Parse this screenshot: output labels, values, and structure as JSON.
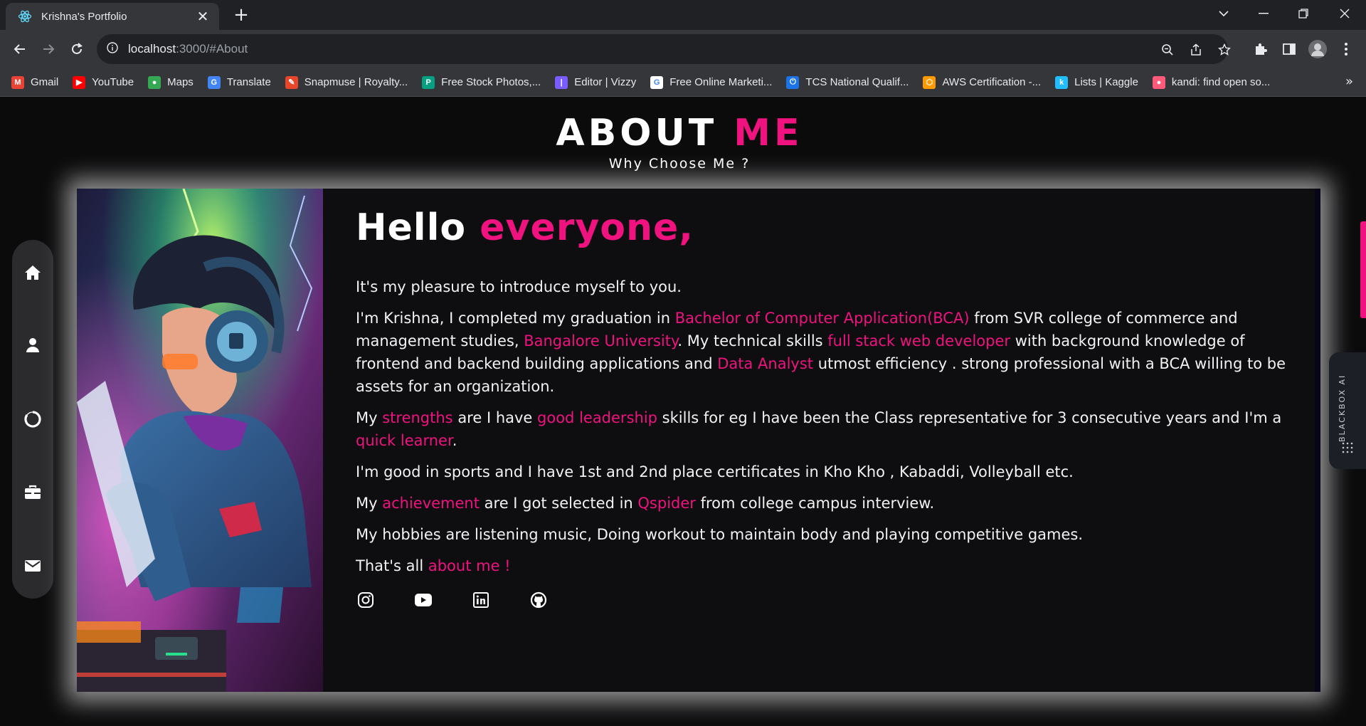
{
  "browser": {
    "tab_title": "Krishna's Portfolio",
    "tab_close": "✕",
    "new_tab": "+",
    "url_host": "localhost",
    "url_path": ":3000/#About",
    "bookmarks": [
      {
        "label": "Gmail",
        "color": "#ea4335",
        "glyph": "M"
      },
      {
        "label": "YouTube",
        "color": "#ff0000",
        "glyph": "▶"
      },
      {
        "label": "Maps",
        "color": "#34a853",
        "glyph": "●"
      },
      {
        "label": "Translate",
        "color": "#4285f4",
        "glyph": "G"
      },
      {
        "label": "Snapmuse | Royalty...",
        "color": "#e8462a",
        "glyph": "✎"
      },
      {
        "label": "Free Stock Photos,...",
        "color": "#05a081",
        "glyph": "P"
      },
      {
        "label": "Editor | Vizzy",
        "color": "#7a5cff",
        "glyph": "|"
      },
      {
        "label": "Free Online Marketi...",
        "color": "#ffffff",
        "glyph": "G"
      },
      {
        "label": "TCS National Qualif...",
        "color": "#1a73e8",
        "glyph": "⏻"
      },
      {
        "label": "AWS Certification -...",
        "color": "#ff9900",
        "glyph": "⬡"
      },
      {
        "label": "Lists | Kaggle",
        "color": "#20beff",
        "glyph": "k"
      },
      {
        "label": "kandi: find open so...",
        "color": "#ff5a7a",
        "glyph": "●"
      }
    ],
    "bookmarks_more": "»"
  },
  "about": {
    "title_white": "ABOUT",
    "title_pink": "ME",
    "subtitle": "Why Choose Me ?",
    "hello_white": "Hello",
    "hello_pink": "everyone,",
    "p1": "It's my pleasure to introduce myself to you.",
    "p2": [
      {
        "t": "I'm Krishna, I completed my graduation in ",
        "h": false
      },
      {
        "t": "Bachelor of Computer Application(BCA)",
        "h": true
      },
      {
        "t": " from SVR college of commerce and management studies, ",
        "h": false
      },
      {
        "t": "Bangalore University",
        "h": true
      },
      {
        "t": ". My technical skills ",
        "h": false
      },
      {
        "t": "full stack web developer",
        "h": true
      },
      {
        "t": " with background knowledge of frontend and backend building applications and ",
        "h": false
      },
      {
        "t": "Data Analyst",
        "h": true
      },
      {
        "t": " utmost efficiency . strong professional with a BCA willing to be assets for an organization.",
        "h": false
      }
    ],
    "p3": [
      {
        "t": "My ",
        "h": false
      },
      {
        "t": "strengths",
        "h": true
      },
      {
        "t": " are I have ",
        "h": false
      },
      {
        "t": "good leadership",
        "h": true
      },
      {
        "t": " skills for eg I have been the Class representative for 3 consecutive years and I'm a ",
        "h": false
      },
      {
        "t": "quick learner",
        "h": true
      },
      {
        "t": ".",
        "h": false
      }
    ],
    "p4": "I'm good in sports and I have 1st and 2nd place certificates in Kho Kho , Kabaddi, Volleyball etc.",
    "p5": [
      {
        "t": "My ",
        "h": false
      },
      {
        "t": "achievement",
        "h": true
      },
      {
        "t": " are I got selected in ",
        "h": false
      },
      {
        "t": "Qspider",
        "h": true
      },
      {
        "t": " from college campus interview.",
        "h": false
      }
    ],
    "p6": "My hobbies are listening music, Doing workout to maintain body and playing competitive games.",
    "p7_white": "That's all ",
    "p7_pink": "about me !",
    "socials": [
      "instagram-icon",
      "youtube-icon",
      "linkedin-icon",
      "github-icon"
    ]
  },
  "sidenav": [
    "home-icon",
    "user-icon",
    "skills-icon",
    "briefcase-icon",
    "mail-icon"
  ],
  "blackbox_label": "BLACKBOX AI",
  "colors": {
    "accent": "#f0127f",
    "background": "#0b0b0c"
  }
}
